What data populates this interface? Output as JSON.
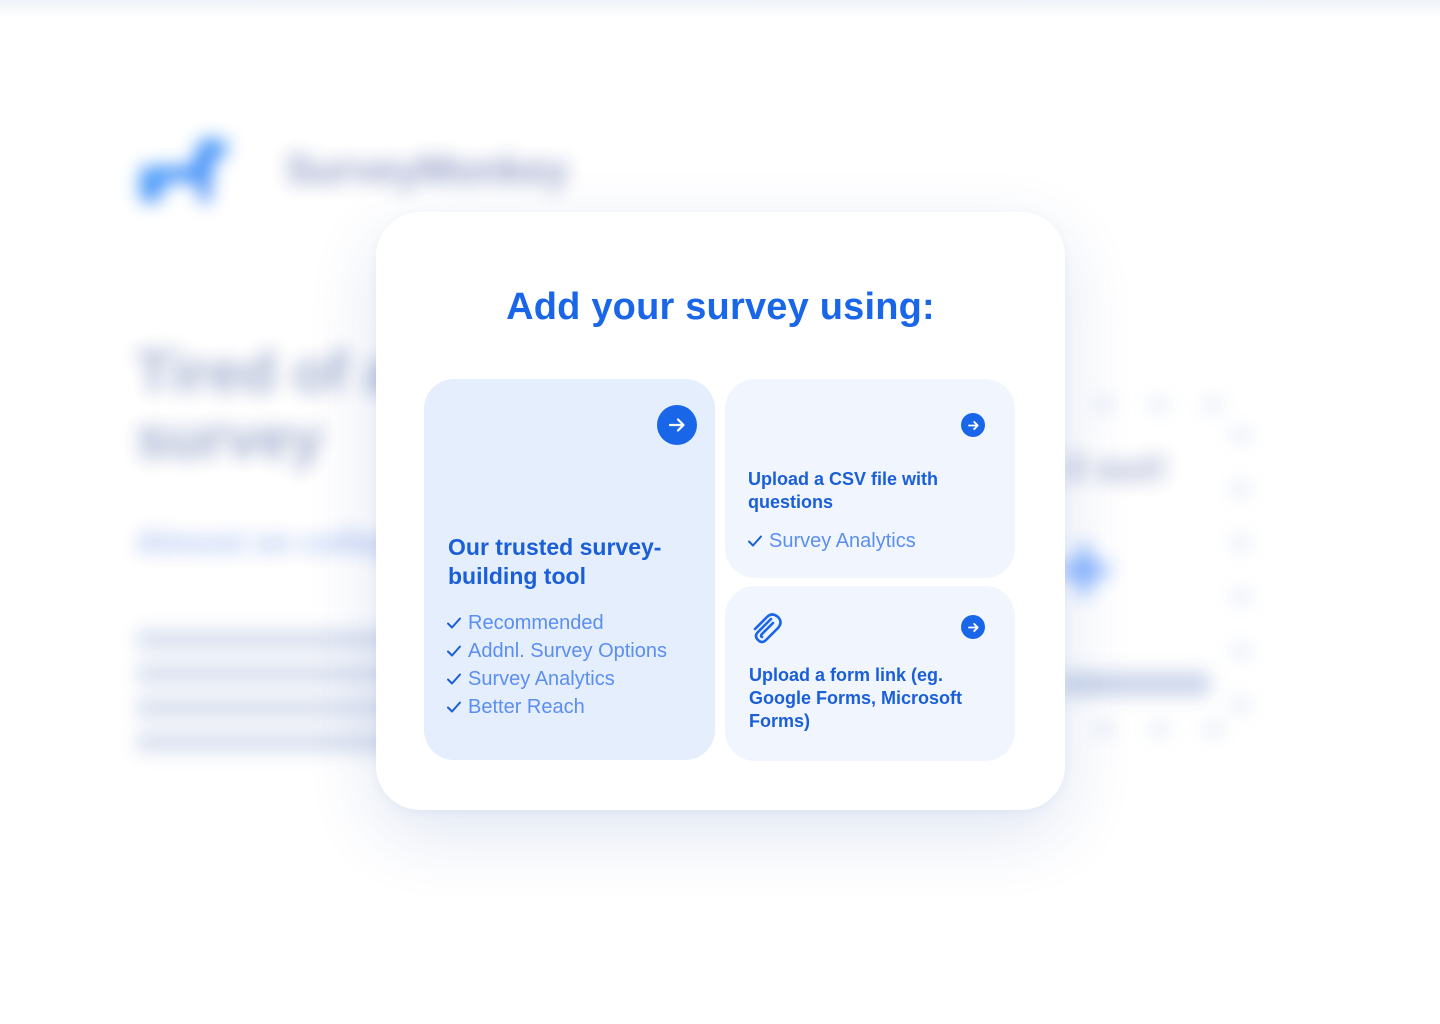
{
  "background": {
    "brand_name": "SurveyMonkey",
    "hero_title": "Tired of a fill survey",
    "hero_subtitle": "Almost on college gives you",
    "right_title": "il out!"
  },
  "modal": {
    "title": "Add your survey using:"
  },
  "options": {
    "builder": {
      "heading": "Our trusted survey-building tool",
      "features": [
        "Recommended",
        "Addnl. Survey Options",
        "Survey Analytics",
        "Better Reach"
      ]
    },
    "csv": {
      "heading": "Upload a CSV file with questions",
      "features": [
        "Survey Analytics"
      ]
    },
    "form_link": {
      "heading": "Upload a form link (eg. Google Forms, Microsoft Forms)"
    }
  },
  "icons": {
    "arrow": "arrow-right-icon",
    "check": "check-icon",
    "tool": "survey-tool-logo-icon",
    "paperclip": "paperclip-icon"
  },
  "colors": {
    "accent": "#1a66e8",
    "heading": "#1a5ed8",
    "feature_text": "#5b8ef0",
    "card_primary": "#e4eefd",
    "card_secondary": "#f1f6fe"
  }
}
